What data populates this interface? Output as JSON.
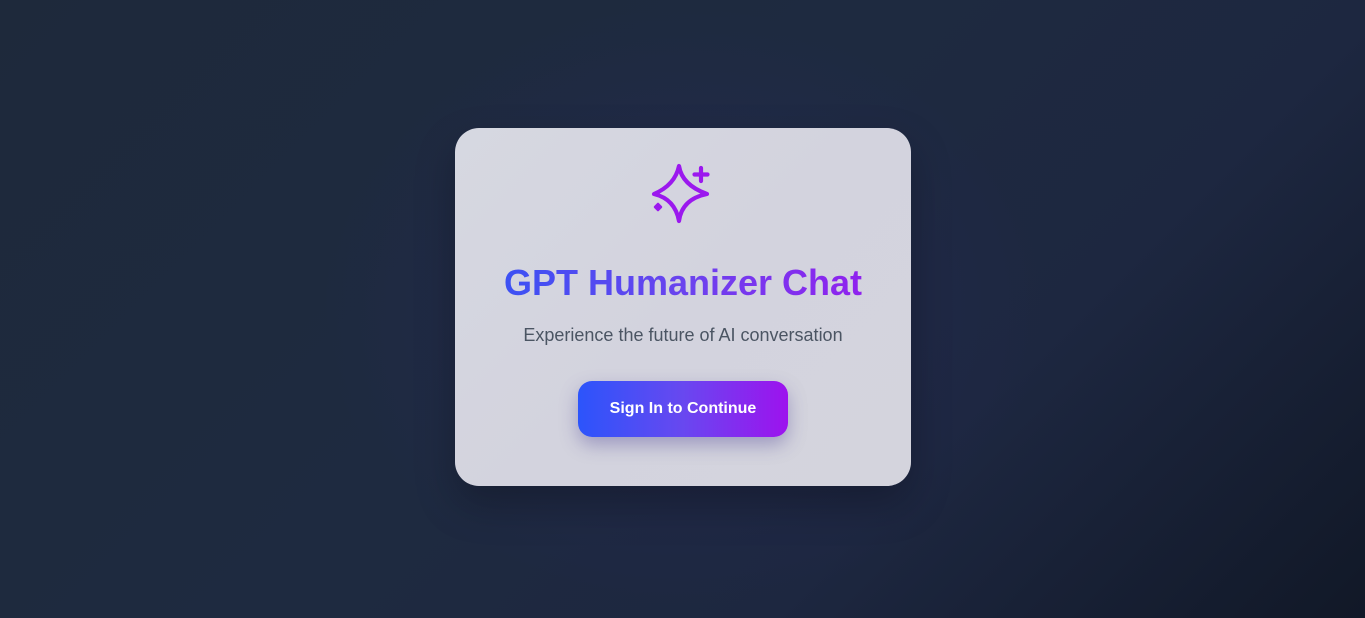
{
  "brand": {
    "title": "GPT Humanizer Chat",
    "subtitle": "Experience the future of AI conversation",
    "logo_icon": "sparkles-icon",
    "gradient_start": "#2f55f5",
    "gradient_end": "#9a19ee",
    "icon_color": "#9b18ee"
  },
  "auth": {
    "sign_in_label": "Sign In to Continue"
  }
}
